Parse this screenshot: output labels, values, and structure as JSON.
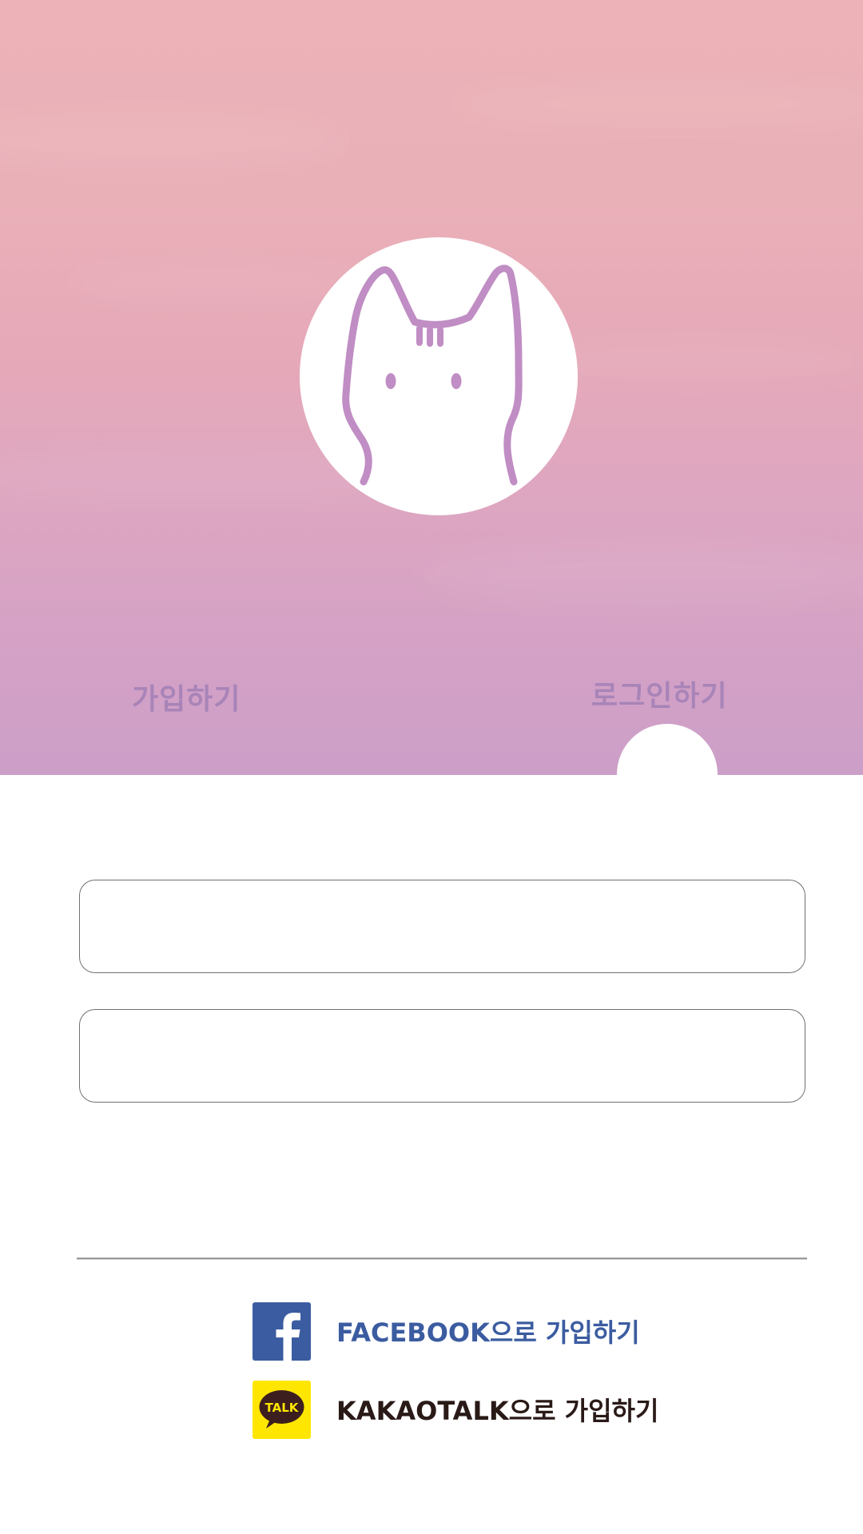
{
  "tabs": {
    "signup_label": "가입하기",
    "login_label": "로그인하기",
    "active": "login"
  },
  "form": {
    "id_field": {
      "value": "",
      "placeholder": ""
    },
    "password_field": {
      "value": "",
      "placeholder": ""
    }
  },
  "social": {
    "facebook_label": "FACEBOOK으로 가입하기",
    "kakao_label": "KAKAOTALK으로 가입하기",
    "kakao_icon_text": "TALK"
  },
  "colors": {
    "gradient_top": "#ecb2b7",
    "gradient_bottom": "#cc9fc8",
    "tab_text": "#a884b8",
    "cat_line": "#c08dc4",
    "facebook_blue": "#3b5ca0",
    "kakao_yellow": "#ffe600",
    "kakao_brown": "#3c1e1e"
  },
  "icons": {
    "logo": "cat-face-icon",
    "facebook": "facebook-icon",
    "kakao": "kakaotalk-icon"
  }
}
